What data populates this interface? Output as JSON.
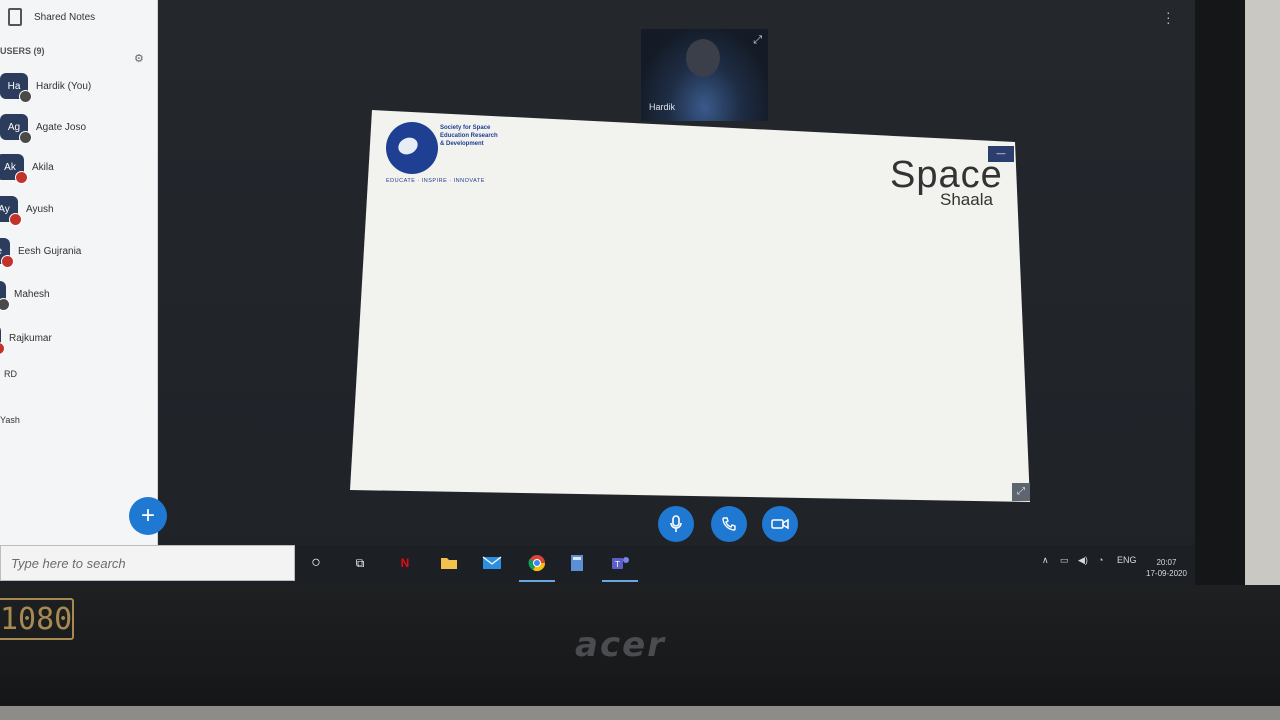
{
  "users_panel": {
    "shared_notes_label": "Shared Notes",
    "header": "USERS (9)",
    "users": [
      {
        "initials": "Ha",
        "name": "Hardik (You)"
      },
      {
        "initials": "Ag",
        "name": "Agate Joso"
      },
      {
        "initials": "Ak",
        "name": "Akila"
      },
      {
        "initials": "Ay",
        "name": "Ayush"
      },
      {
        "initials": "Ee",
        "name": "Eesh Gujrania"
      },
      {
        "initials": "Ma",
        "name": "Mahesh"
      },
      {
        "initials": "Ra",
        "name": "Rajkumar"
      },
      {
        "initials": "",
        "name": "RD"
      },
      {
        "initials": "",
        "name": "Yash"
      }
    ]
  },
  "presenter": {
    "name": "Hardik"
  },
  "slide": {
    "org_name": "Society for Space Education Research & Development",
    "org_tagline": "EDUCATE · INSPIRE · INNOVATE",
    "brand_title": "Space",
    "brand_subtitle": "Shaala"
  },
  "taskbar": {
    "search_placeholder": "Type here to search",
    "language": "ENG",
    "time": "20:07",
    "date": "17-09-2020"
  },
  "hardware": {
    "resolution_badge": "1080",
    "laptop_brand": "acer"
  },
  "colors": {
    "accent_blue": "#1f78d1",
    "org_blue": "#1f3f93"
  }
}
